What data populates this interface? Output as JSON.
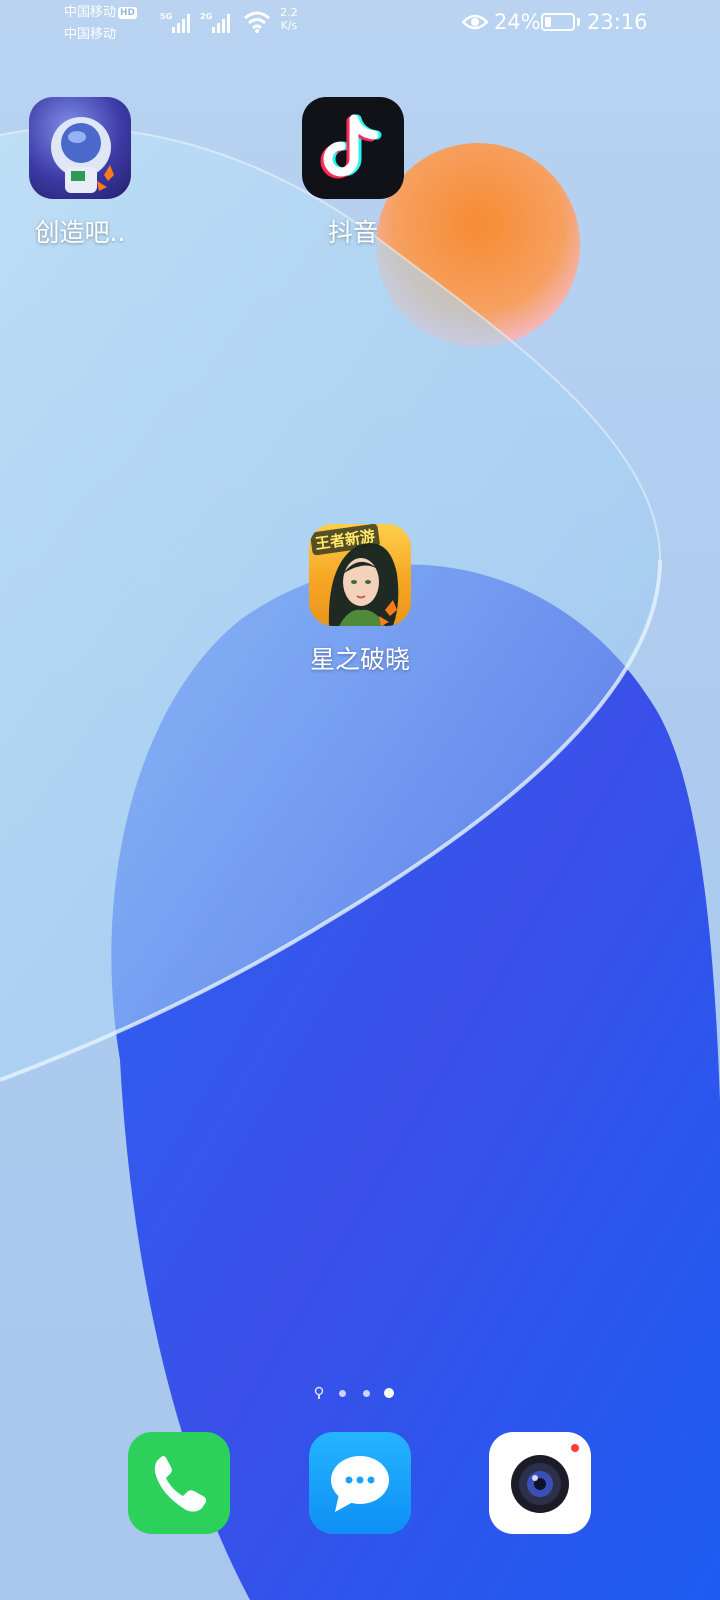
{
  "status_bar": {
    "carrier1": "中国移动",
    "hd": "HD",
    "carrier2": "中国移动",
    "net1": "5G",
    "net2": "2G",
    "speed_value": "2.2",
    "speed_unit": "K/s",
    "battery": "24%",
    "battery_level": 0.24,
    "time": "23:16"
  },
  "apps": [
    {
      "label": "创造吧..",
      "icon": "astronaut-game-icon"
    },
    {
      "label": "抖音",
      "icon": "douyin-icon"
    },
    {
      "label": "星之破晓",
      "icon": "game-character-icon",
      "badge": "王者新游"
    }
  ],
  "page_indicator": {
    "pages": 4,
    "active_index": 3,
    "first_is_home": true
  },
  "dock": [
    {
      "name": "phone",
      "icon": "phone-icon",
      "color": "#2bd15a"
    },
    {
      "name": "messages",
      "icon": "message-icon",
      "color": "#1aa2ff"
    },
    {
      "name": "camera",
      "icon": "camera-icon",
      "color": "#ffffff"
    }
  ],
  "colors": {
    "wallpaper_blue": "#1f4ef0",
    "wallpaper_light": "#b9d3f1",
    "orange_sphere": "#f58a35"
  }
}
